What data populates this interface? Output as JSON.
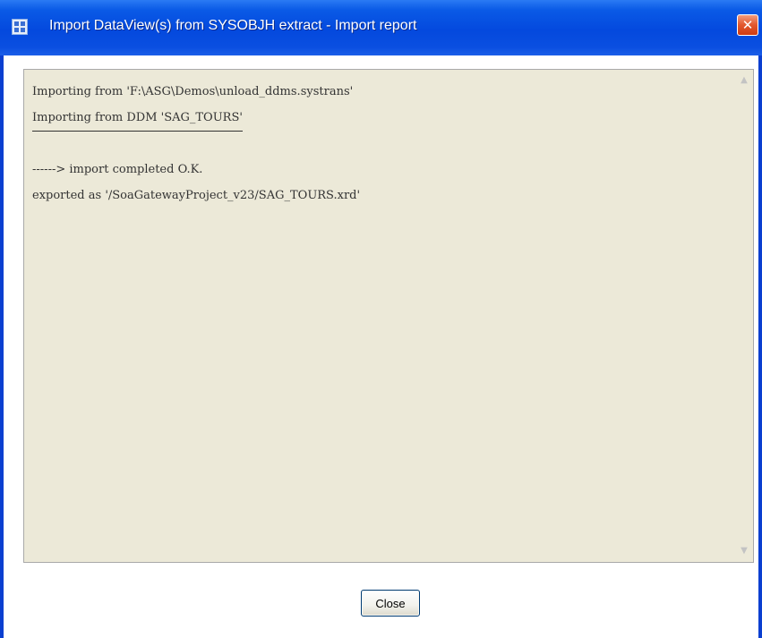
{
  "window": {
    "title": "Import DataView(s) from SYSOBJH extract  -  Import report",
    "icon": "grid-app-icon",
    "close_glyph": "✕"
  },
  "report": {
    "lines": [
      "Importing from 'F:\\ASG\\Demos\\unload_ddms.systrans'",
      "Importing from DDM 'SAG_TOURS'",
      "",
      "------> import completed O.K.",
      "exported as '/SoaGatewayProject_v23/SAG_TOURS.xrd'"
    ]
  },
  "buttons": {
    "close_label": "Close"
  },
  "colors": {
    "titlebar": "#0449de",
    "report_bg": "#ece9d8",
    "close_x": "#e2572d"
  }
}
